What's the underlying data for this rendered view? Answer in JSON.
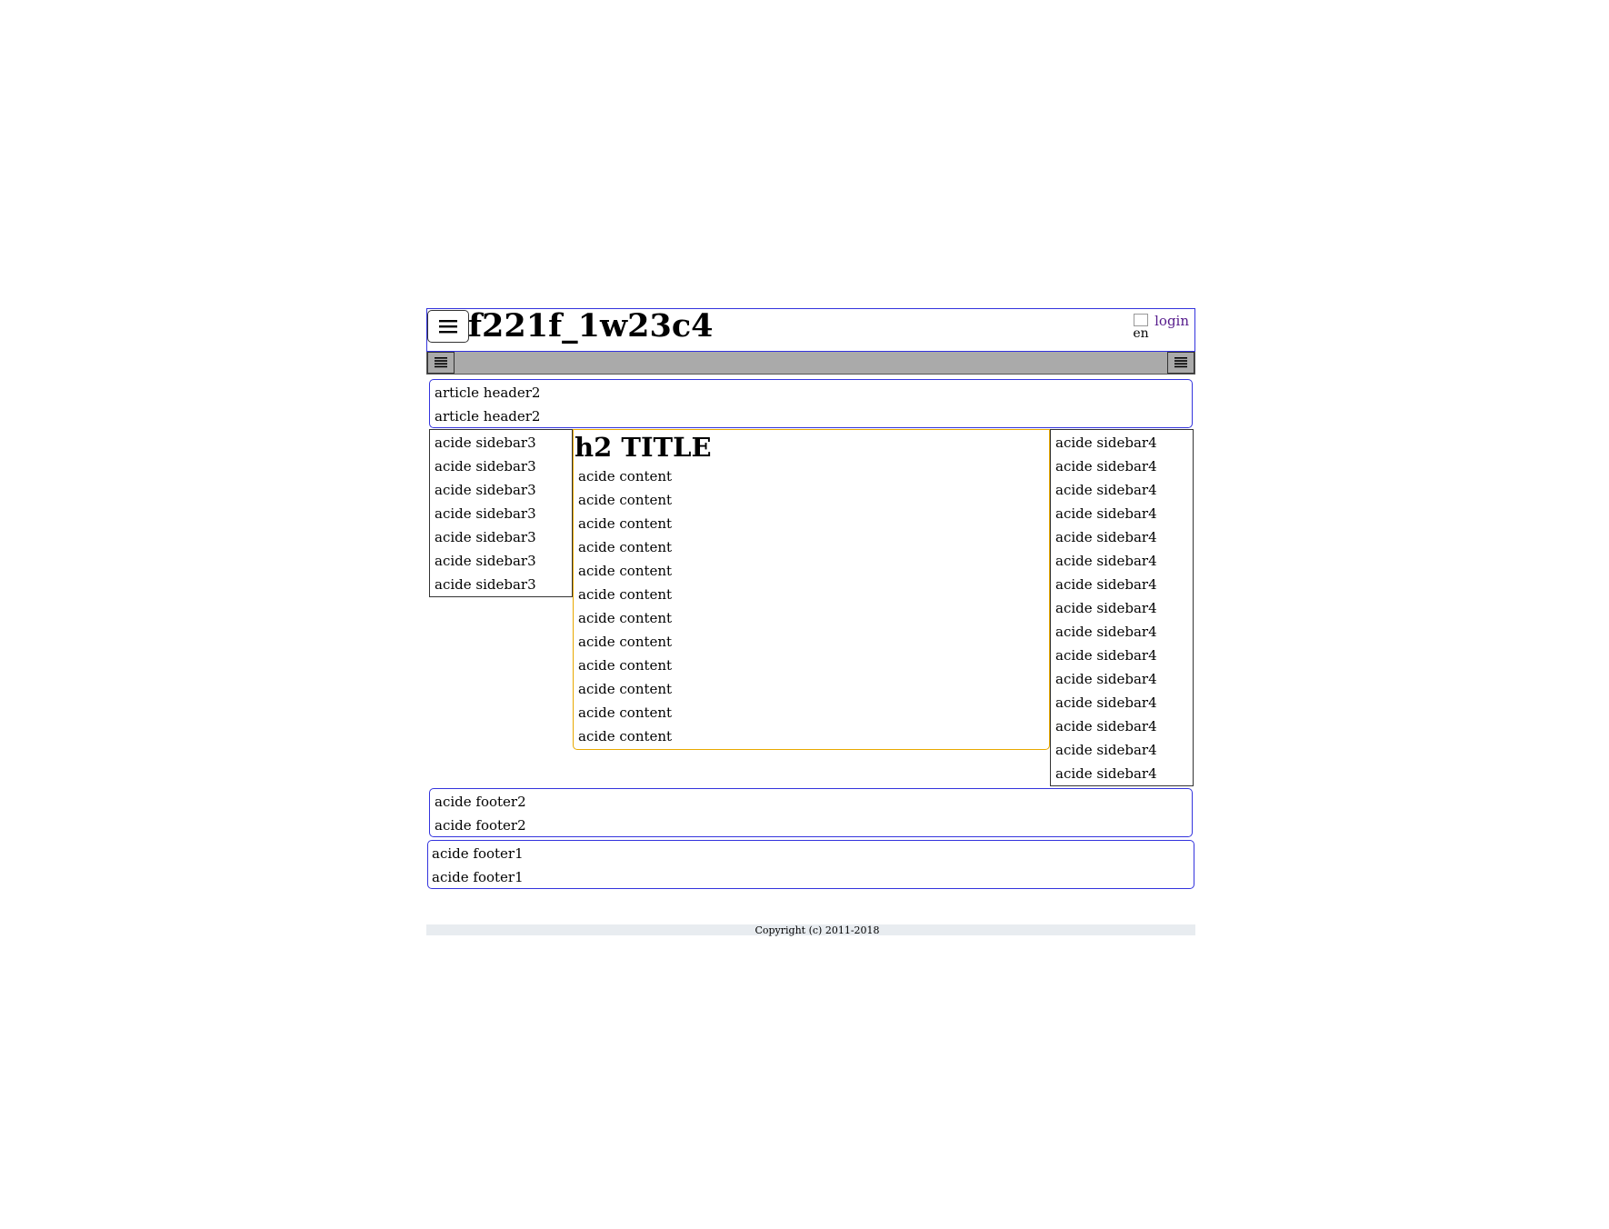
{
  "header": {
    "title": "f221f_1w23c4",
    "lang_alt": "en",
    "login_label": "login",
    "menu_icon": "hamburger-icon"
  },
  "toolbar": {
    "left_icon": "list-icon",
    "right_icon": "list-icon"
  },
  "article_header": {
    "lines": [
      "article header2",
      "article header2"
    ]
  },
  "sidebar3": {
    "lines": [
      "acide sidebar3",
      "acide sidebar3",
      "acide sidebar3",
      "acide sidebar3",
      "acide sidebar3",
      "acide sidebar3",
      "acide sidebar3"
    ]
  },
  "content": {
    "title": "h2 TITLE",
    "lines": [
      "acide content",
      "acide content",
      "acide content",
      "acide content",
      "acide content",
      "acide content",
      "acide content",
      "acide content",
      "acide content",
      "acide content",
      "acide content",
      "acide content"
    ]
  },
  "sidebar4": {
    "lines": [
      "acide sidebar4",
      "acide sidebar4",
      "acide sidebar4",
      "acide sidebar4",
      "acide sidebar4",
      "acide sidebar4",
      "acide sidebar4",
      "acide sidebar4",
      "acide sidebar4",
      "acide sidebar4",
      "acide sidebar4",
      "acide sidebar4",
      "acide sidebar4",
      "acide sidebar4",
      "acide sidebar4"
    ]
  },
  "footer2": {
    "lines": [
      "acide footer2",
      "acide footer2"
    ]
  },
  "footer1": {
    "lines": [
      "acide footer1",
      "acide footer1"
    ]
  },
  "copyright": "Copyright (c) 2011-2018",
  "colors": {
    "header_border": "#3333dd",
    "content_border": "#e8a800",
    "toolbar_bg": "#aaaaaa",
    "login_link": "#551a8b"
  }
}
